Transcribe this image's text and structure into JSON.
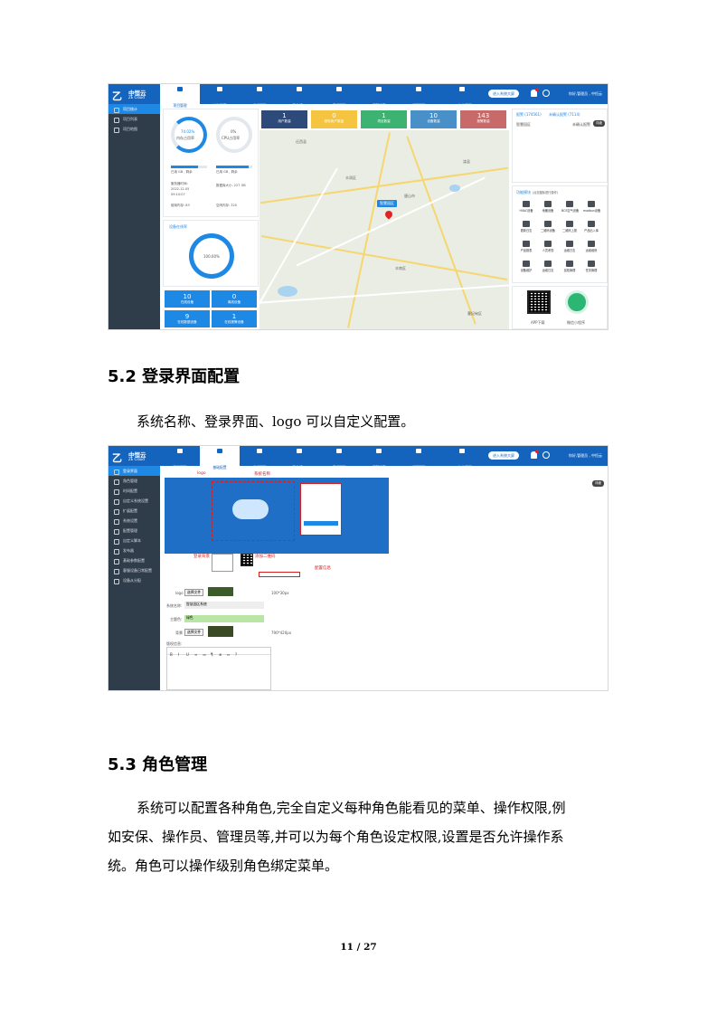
{
  "screenshot1": {
    "brand": {
      "mark": "乙",
      "name": "中恒云",
      "en": "ZE Cloud"
    },
    "tabs": [
      "项目管理",
      "基础配置",
      "组织管理",
      "硬件接入",
      "模板管理",
      "报警设置",
      "搬家管理",
      "CTI作业管理"
    ],
    "top_right": {
      "bigscreen": "进入系统大屏",
      "user": "你好,管理员 , 中恒云"
    },
    "sidebar": [
      "项目统计",
      "项目列表",
      "项目地图"
    ],
    "gauges": {
      "memory_value": "74.02%",
      "memory_label": "内存占用率",
      "cpu_value": "0%",
      "cpu_label": "CPU占用率"
    },
    "server_info": [
      "已用 GB , 剩余",
      "已用 GB , 剩余",
      "服务器时间:",
      "2022-12-05",
      "09:10:07",
      "数据库大小: 227 GB",
      "使用内存: 83",
      "空闲内存: 320"
    ],
    "device_rate": {
      "title": "设备在线率",
      "value": "100.00%"
    },
    "cards": [
      {
        "n": "10",
        "l": "在线设备"
      },
      {
        "n": "0",
        "l": "离线设备"
      },
      {
        "n": "9",
        "l": "在线数据设备"
      },
      {
        "n": "1",
        "l": "在线报警设备"
      }
    ],
    "kpis": [
      {
        "n": "1",
        "l": "用户数量",
        "color": "#2d4a7a"
      },
      {
        "n": "0",
        "l": "超标用户数量",
        "color": "#f5c542"
      },
      {
        "n": "1",
        "l": "项目数量",
        "color": "#3cb371"
      },
      {
        "n": "10",
        "l": "设备数量",
        "color": "#4a90c8"
      },
      {
        "n": "143",
        "l": "报警数量",
        "color": "#c96a6a"
      }
    ],
    "map_labels": [
      "唐山市",
      "滦县",
      "丰南区",
      "丰润区",
      "迁西县",
      "曹妃甸区"
    ],
    "map_badge": "智慧园区",
    "right_panel": {
      "tabs": [
        "报警 (174561)",
        "未确认报警 (7114)"
      ],
      "row": "智慧园区",
      "row_right": "未确认报警",
      "badge": "详细"
    },
    "functions_title": "功能模块",
    "functions_sub": "(点击图标进行操作)",
    "functions": [
      "HVAC设备",
      "地暖设备",
      "BCS空气设备",
      "modbus设备",
      "更新日志",
      "二维码设备",
      "二维码上报",
      "产品出入库",
      "产品报表",
      "人员考勤",
      "运维日志",
      "运维维修",
      "设备维护",
      "运维日志",
      "巡检管理",
      "任务管理"
    ],
    "qr_labels": [
      "微信小程序",
      "APP下载"
    ]
  },
  "section_52": {
    "heading": "5.2 登录界面配置",
    "text": "系统名称、登录界面、logo 可以自定义配置。"
  },
  "screenshot2": {
    "sidebar": [
      "登录界面",
      "角色管理",
      "时间配置",
      "自定义系统设置",
      "扩展配置",
      "系统设置",
      "配置管理",
      "自定义脚本",
      "发布器",
      "基础参数配置",
      "客服设备日常配置",
      "设备从分配"
    ],
    "annotations": {
      "logo": "logo",
      "sysname": "系统名称",
      "bg": "登录背景",
      "qr": "添加二维码",
      "config": "配置信息"
    },
    "badge": "详细",
    "form": {
      "logo_label": "logo",
      "logo_btn": "选择文件",
      "logo_size": "100*30px",
      "name_label": "系统名称:",
      "name_value": "智慧园区系统",
      "color_label": "主题色:",
      "color_value": "绿色",
      "bg_label": "背景",
      "bg_btn": "选择文件",
      "bg_size": "790*420px",
      "editor_label": "版权信息:",
      "editor_tools": [
        "B",
        "I",
        "U",
        "≡",
        "≔",
        "¶",
        "⊕",
        "⇔",
        "?"
      ]
    }
  },
  "section_53": {
    "heading": "5.3 角色管理",
    "lines": [
      "系统可以配置各种角色,完全自定义每种角色能看见的菜单、操作权限,例",
      "如安保、操作员、管理员等,并可以为每个角色设定权限,设置是否允许操作系",
      "统。角色可以操作级别角色绑定菜单。"
    ]
  },
  "page_number": "11 / 27"
}
